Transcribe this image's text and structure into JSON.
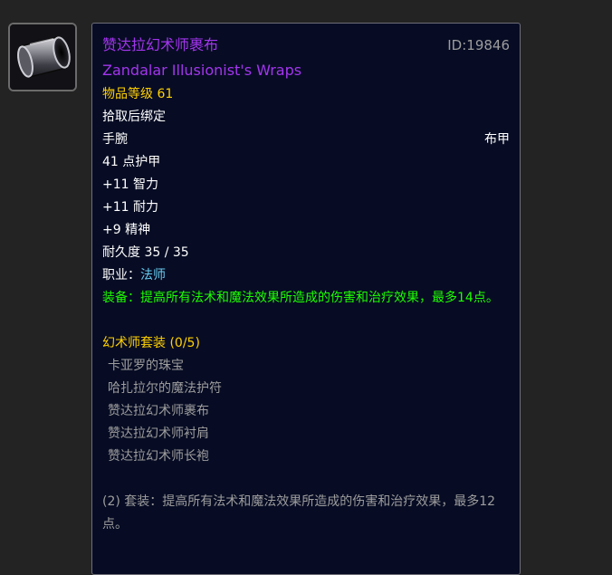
{
  "icon": {
    "name": "bracer-wrap-icon"
  },
  "item": {
    "name_cn": "赞达拉幻术师裹布",
    "id_label": "ID:19846",
    "name_en": "Zandalar Illusionist's Wraps",
    "item_level": "物品等级 61",
    "bind": "拾取后绑定",
    "slot": "手腕",
    "armor_type": "布甲",
    "armor": "41 点护甲",
    "stats": [
      "+11 智力",
      "+11 耐力",
      "+9 精神"
    ],
    "durability": "耐久度 35 / 35",
    "class_label": "职业：",
    "class_value": "法师",
    "equip_effect": "装备：提高所有法术和魔法效果所造成的伤害和治疗效果，最多14点。"
  },
  "set": {
    "title": "幻术师套装 (0/5)",
    "items": [
      "卡亚罗的珠宝",
      "哈扎拉尔的魔法护符",
      "赞达拉幻术师裹布",
      "赞达拉幻术师衬肩",
      "赞达拉幻术师长袍"
    ],
    "bonus": "(2) 套装：提高所有法术和魔法效果所造成的伤害和治疗效果，最多12点。"
  },
  "colors": {
    "epic": "#a335ee",
    "gold": "#ffd100",
    "class": "#69ccf0",
    "equip": "#1eff00",
    "inactive": "#9d9d9d"
  }
}
